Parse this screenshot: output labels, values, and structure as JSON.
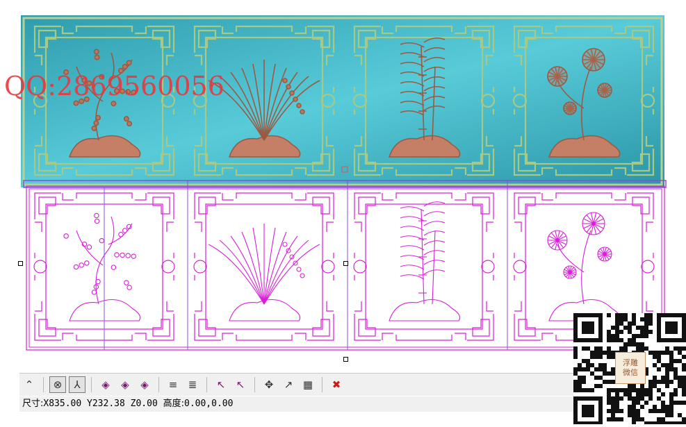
{
  "watermark": {
    "text": "QQ:2869560056"
  },
  "canvas": {
    "relief_panel_count": 4,
    "vector_panel_count": 4,
    "colors": {
      "relief_bg": "#3fb7c6",
      "relief_frame": "#c7d9a8",
      "relief_carving": "#c9826a",
      "vector_line": "#d81ed8",
      "selection": "#8a4fd8",
      "handle": "#e05050"
    },
    "panels": [
      {
        "subject": "plum-blossom"
      },
      {
        "subject": "orchid"
      },
      {
        "subject": "bamboo"
      },
      {
        "subject": "chrysanthemum"
      }
    ]
  },
  "toolbar": {
    "buttons": [
      {
        "icon": "small-arrow-icon",
        "active": false
      },
      {
        "icon": "target-circle-icon",
        "active": true
      },
      {
        "icon": "axis-icon",
        "active": true
      },
      {
        "icon": "diamond-node-icon",
        "active": false
      },
      {
        "icon": "diamond-arrow-icon",
        "active": false
      },
      {
        "icon": "diamond-cross-icon",
        "active": false
      },
      {
        "icon": "layer-base-icon",
        "active": false
      },
      {
        "icon": "layer-stack-icon",
        "active": false
      },
      {
        "icon": "select-point-icon",
        "active": false
      },
      {
        "icon": "deselect-point-icon",
        "active": false
      },
      {
        "icon": "transform-node-icon",
        "active": false
      },
      {
        "icon": "edit-curve-icon",
        "active": false
      },
      {
        "icon": "grid-edit-icon",
        "active": false
      },
      {
        "icon": "delete-x-icon",
        "active": false
      }
    ]
  },
  "status": {
    "label": "尺寸:",
    "x": "X835.00",
    "y": "Y232.38",
    "z": "Z0.00",
    "height_label": "高度:",
    "height_value": "0.00,0.00"
  },
  "qr": {
    "line1": "浮雕",
    "line2": "微信"
  }
}
